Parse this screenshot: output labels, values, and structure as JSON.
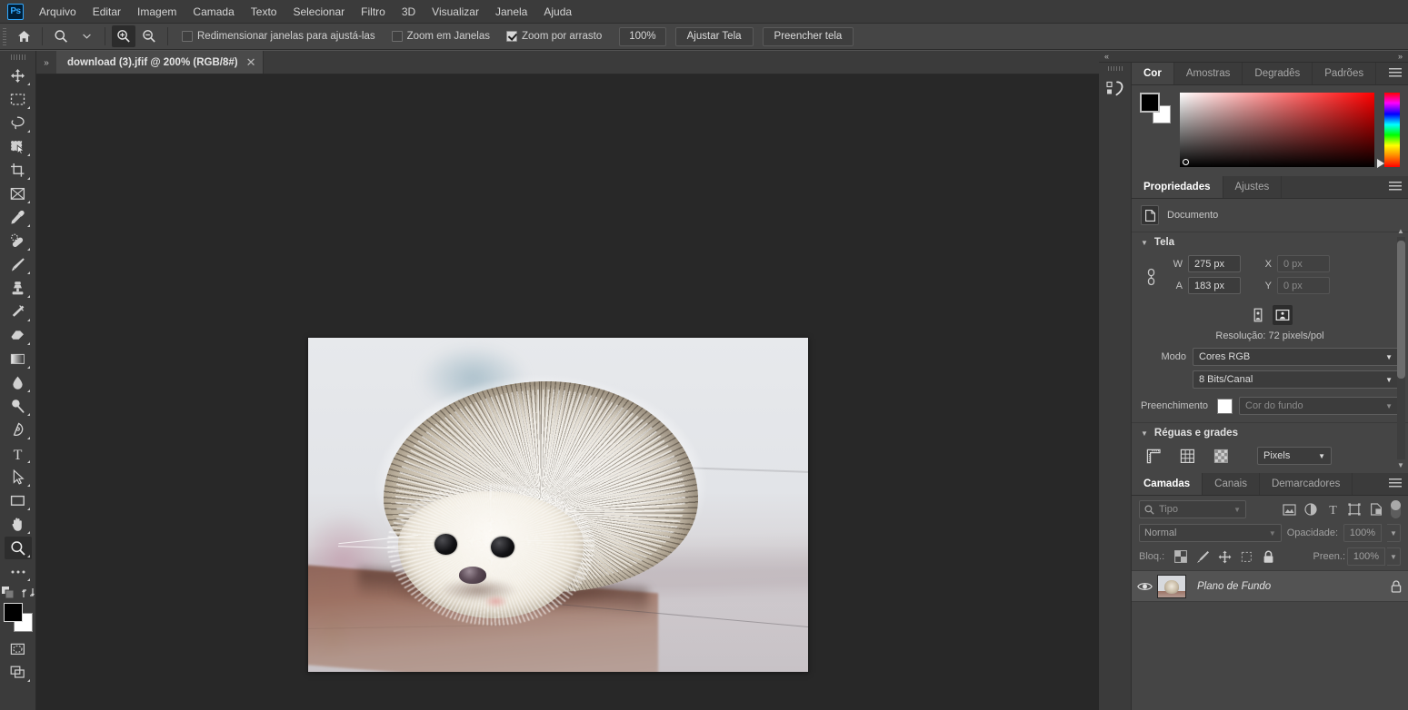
{
  "app": {
    "logo": "Ps",
    "title": "Adobe Photoshop"
  },
  "menubar": {
    "items": [
      {
        "label": "Arquivo"
      },
      {
        "label": "Editar"
      },
      {
        "label": "Imagem"
      },
      {
        "label": "Camada"
      },
      {
        "label": "Texto"
      },
      {
        "label": "Selecionar"
      },
      {
        "label": "Filtro"
      },
      {
        "label": "3D"
      },
      {
        "label": "Visualizar"
      },
      {
        "label": "Janela"
      },
      {
        "label": "Ajuda"
      }
    ]
  },
  "options_bar": {
    "home_icon": "home-icon",
    "tool_icon": "zoom-tool-icon",
    "zoom_in_icon": "zoom-in-icon",
    "zoom_out_icon": "zoom-out-icon",
    "checkboxes": [
      {
        "label": "Redimensionar janelas para ajustá-las",
        "checked": false
      },
      {
        "label": "Zoom em Janelas",
        "checked": false
      },
      {
        "label": "Zoom por arrasto",
        "checked": true
      }
    ],
    "zoom_value": "100%",
    "fit_screen_label": "Ajustar Tela",
    "fill_screen_label": "Preencher tela"
  },
  "toolbar": {
    "tools": [
      {
        "name": "move-tool",
        "icon": "move-icon"
      },
      {
        "name": "rectangular-marquee-tool",
        "icon": "marquee-icon"
      },
      {
        "name": "lasso-tool",
        "icon": "lasso-icon"
      },
      {
        "name": "quick-selection-tool",
        "icon": "quick-select-icon"
      },
      {
        "name": "crop-tool",
        "icon": "crop-icon"
      },
      {
        "name": "frame-tool",
        "icon": "frame-icon"
      },
      {
        "name": "eyedropper-tool",
        "icon": "eyedropper-icon"
      },
      {
        "name": "spot-healing-tool",
        "icon": "healing-icon"
      },
      {
        "name": "brush-tool",
        "icon": "brush-icon"
      },
      {
        "name": "clone-stamp-tool",
        "icon": "stamp-icon"
      },
      {
        "name": "history-brush-tool",
        "icon": "history-brush-icon"
      },
      {
        "name": "eraser-tool",
        "icon": "eraser-icon"
      },
      {
        "name": "gradient-tool",
        "icon": "gradient-icon"
      },
      {
        "name": "blur-tool",
        "icon": "blur-drop-icon"
      },
      {
        "name": "dodge-tool",
        "icon": "dodge-icon"
      },
      {
        "name": "pen-tool",
        "icon": "pen-icon"
      },
      {
        "name": "type-tool",
        "icon": "type-T-icon"
      },
      {
        "name": "path-selection-tool",
        "icon": "path-arrow-icon"
      },
      {
        "name": "rectangle-tool",
        "icon": "rectangle-icon"
      },
      {
        "name": "hand-tool",
        "icon": "hand-icon"
      },
      {
        "name": "zoom-tool",
        "icon": "magnifier-icon",
        "active": true
      },
      {
        "name": "more-tools",
        "icon": "ellipsis-icon"
      }
    ],
    "foreground_color": "#000000",
    "background_color": "#ffffff",
    "quick_mask_icon": "quick-mask-icon",
    "screen_mode_icon": "screen-mode-icon"
  },
  "document": {
    "tab_title": "download (3).jfif @ 200% (RGB/8#)",
    "close_icon": "close-icon",
    "collapse_icon": "expand-arrows-icon"
  },
  "right_dock": {
    "collapse_left_icon": "collapse-left-icon",
    "expand_right_icon": "expand-right-icon",
    "strip_icon": "history-actions-icon"
  },
  "color_panel": {
    "tabs": [
      {
        "label": "Cor",
        "active": true
      },
      {
        "label": "Amostras",
        "active": false
      },
      {
        "label": "Degradês",
        "active": false
      },
      {
        "label": "Padrões",
        "active": false
      }
    ],
    "menu_icon": "panel-menu-icon",
    "foreground": "#000000",
    "background": "#ffffff",
    "hue": "#ff0000"
  },
  "properties_panel": {
    "tabs": [
      {
        "label": "Propriedades",
        "active": true
      },
      {
        "label": "Ajustes",
        "active": false
      }
    ],
    "menu_icon": "panel-menu-icon",
    "doc_icon": "document-icon",
    "doc_label": "Documento",
    "canvas_section": {
      "title": "Tela",
      "link_icon": "link-icon",
      "w_label": "W",
      "w_value": "275 px",
      "a_label": "A",
      "a_value": "183 px",
      "x_label": "X",
      "x_value": "0 px",
      "y_label": "Y",
      "y_value": "0 px",
      "portrait_icon": "portrait-orientation-icon",
      "landscape_icon": "landscape-orientation-icon",
      "resolution": "Resolução: 72 pixels/pol",
      "mode_label": "Modo",
      "mode_value": "Cores RGB",
      "depth_value": "8 Bits/Canal",
      "fill_label": "Preenchimento",
      "fill_value": "Cor do fundo"
    },
    "rulers_section": {
      "title": "Réguas e grades",
      "ruler_icon": "ruler-icon",
      "grid_icon": "grid-icon",
      "transparency_icon": "transparency-checker-icon",
      "unit_value": "Pixels"
    }
  },
  "layers_panel": {
    "tabs": [
      {
        "label": "Camadas",
        "active": true
      },
      {
        "label": "Canais",
        "active": false
      },
      {
        "label": "Demarcadores",
        "active": false
      }
    ],
    "menu_icon": "panel-menu-icon",
    "filter_icon": "search-icon",
    "filter_value": "Tipo",
    "filter_types": [
      {
        "name": "filter-pixel-icon"
      },
      {
        "name": "filter-adjustment-icon"
      },
      {
        "name": "filter-type-icon"
      },
      {
        "name": "filter-shape-icon"
      },
      {
        "name": "filter-smart-object-icon"
      }
    ],
    "blend_mode": "Normal",
    "opacity_label": "Opacidade:",
    "opacity_value": "100%",
    "lock_label": "Bloq.:",
    "lock_icons": [
      {
        "name": "lock-transparency-icon"
      },
      {
        "name": "lock-image-icon"
      },
      {
        "name": "lock-position-icon"
      },
      {
        "name": "lock-artboard-icon"
      },
      {
        "name": "lock-all-icon"
      }
    ],
    "fill_label": "Preen.:",
    "fill_value": "100%",
    "layers": [
      {
        "name": "Plano de Fundo",
        "visible": true,
        "locked": true,
        "visibility_icon": "eye-icon",
        "lock_icon": "lock-icon"
      }
    ]
  },
  "canvas": {
    "image_alt": "hedgehog-photo",
    "background_color": "#282828"
  }
}
